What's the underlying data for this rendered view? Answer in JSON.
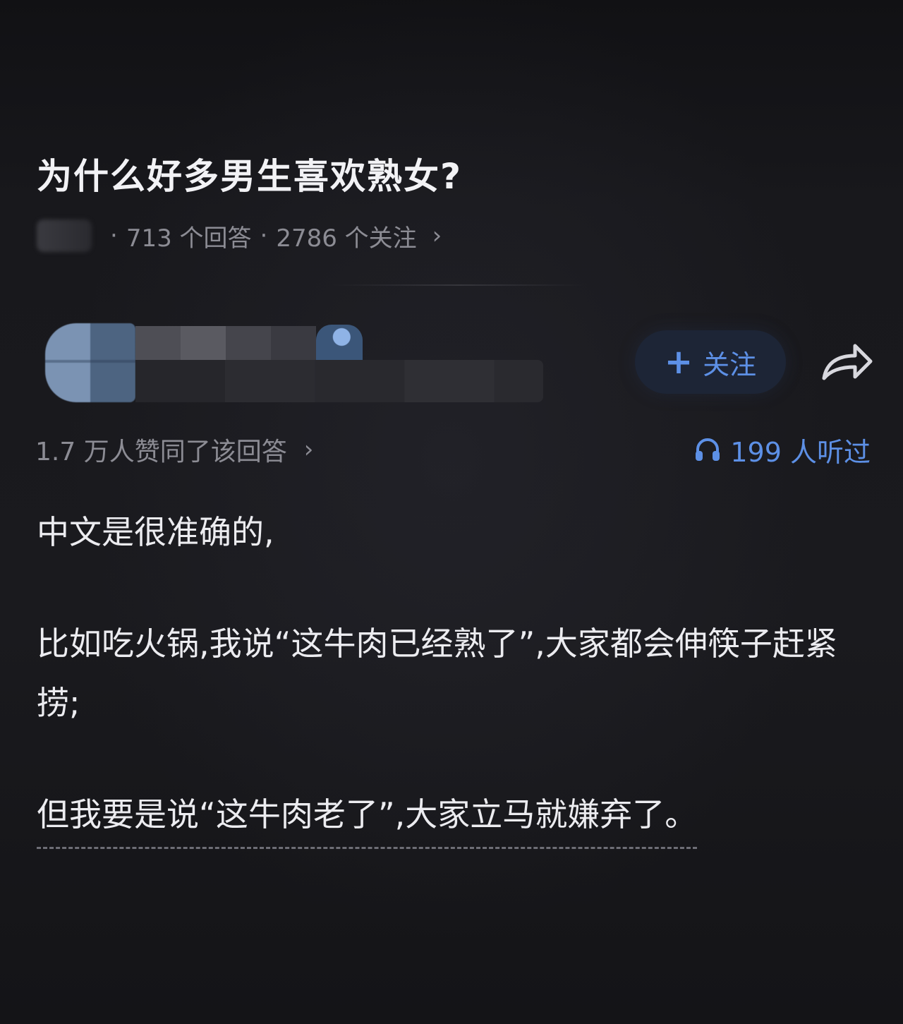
{
  "question": {
    "title": "为什么好多男生喜欢熟女?",
    "meta": {
      "answers": "713 个回答",
      "followers": "2786 个关注"
    }
  },
  "author": {
    "follow_label": "关注"
  },
  "answer": {
    "agree_text": "1.7 万人赞同了该回答",
    "listen_text": "199 人听过",
    "paragraphs": [
      "中文是很准确的,",
      "比如吃火锅,我说“这牛肉已经熟了”,大家都会伸筷子赶紧捞;",
      "但我要是说“这牛肉老了”,大家立马就嫌弃了。"
    ]
  },
  "icons": {
    "follow": "plus-icon",
    "share": "share-arrow-icon",
    "listen": "headphone-icon",
    "more": "chevron-right-icon"
  },
  "colors": {
    "background": "#17171b",
    "accent": "#5d90e6",
    "muted_text": "#8c8c94",
    "primary_text": "#ececf0"
  }
}
